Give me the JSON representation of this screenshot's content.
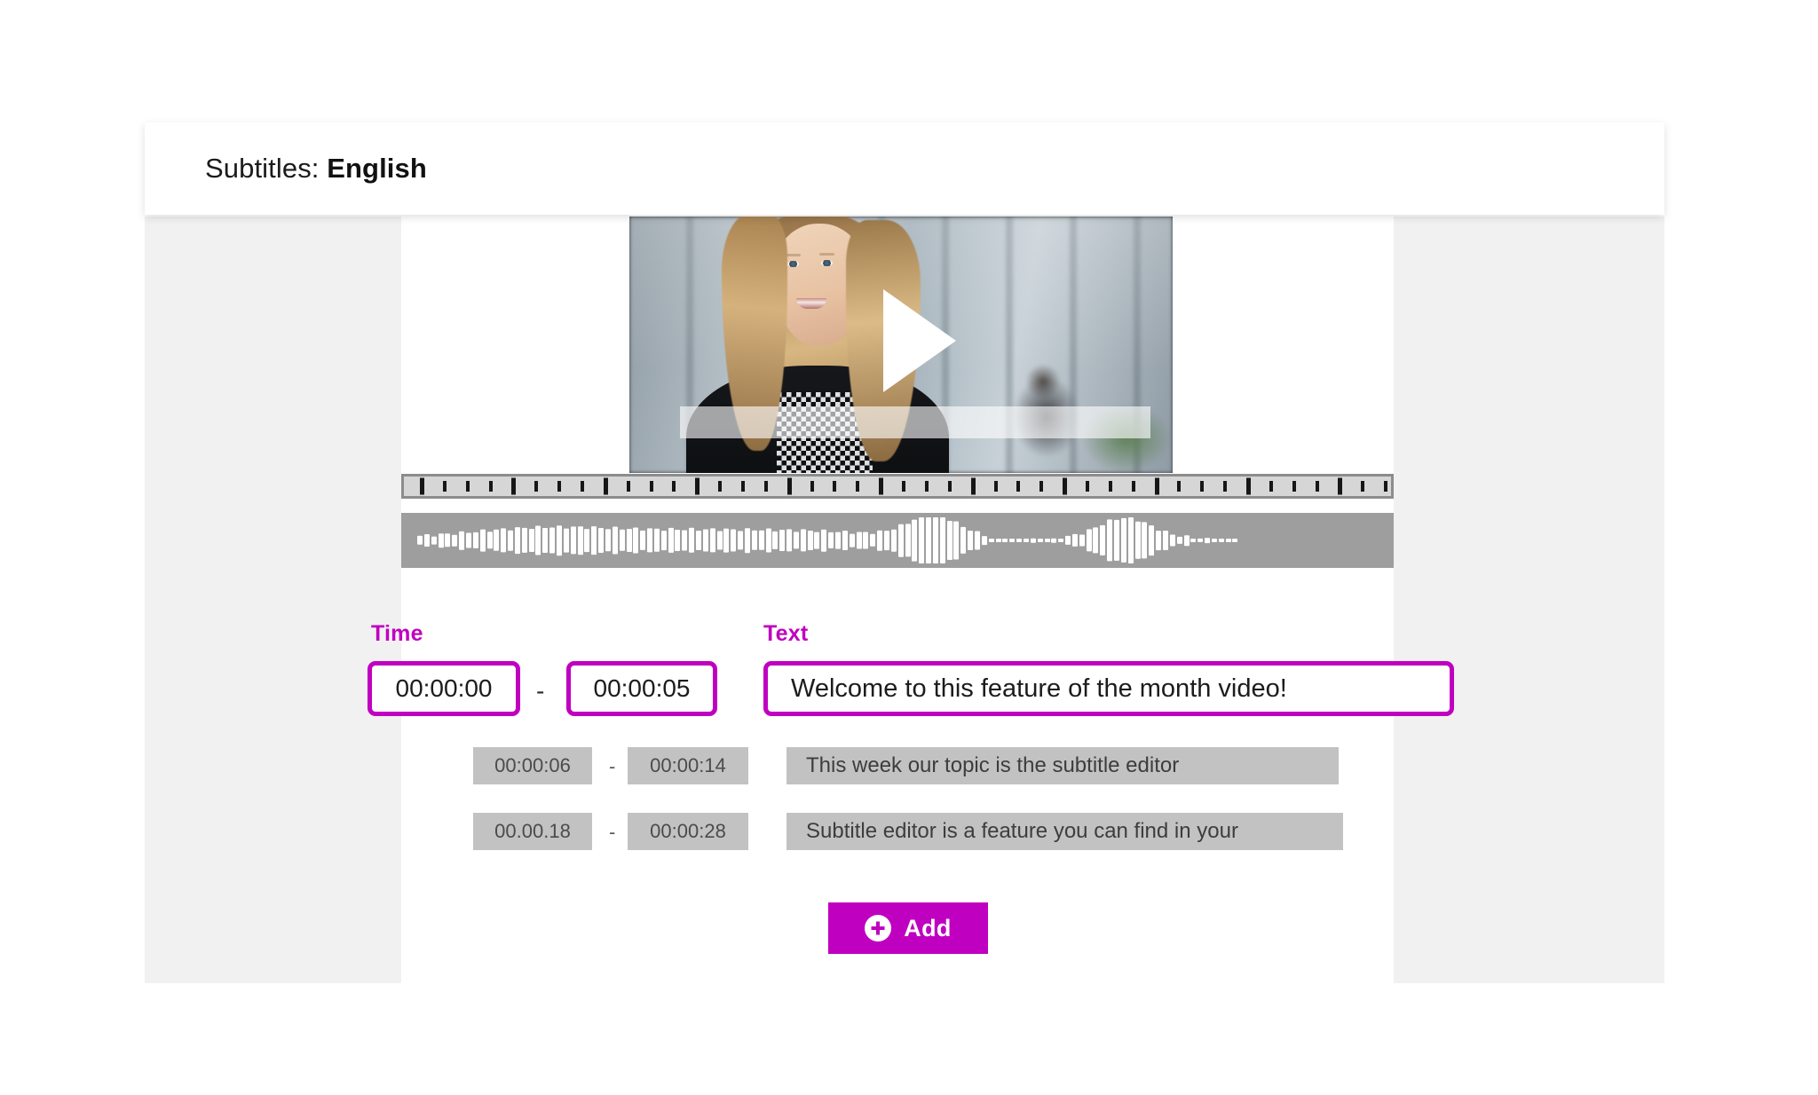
{
  "header": {
    "prefix": "Subtitles:",
    "language": "English"
  },
  "player": {
    "play_icon": "play-triangle-icon",
    "progress_bar": "video-progress-bar"
  },
  "timeline": {
    "ruler_name": "timeline-ruler",
    "waveform_name": "audio-waveform",
    "major_tick_count": 11,
    "minor_ticks_per_major": 3
  },
  "columns": {
    "time_label": "Time",
    "text_label": "Text",
    "separator": "-"
  },
  "subtitles": [
    {
      "active": true,
      "start": "00:00:00",
      "end": "00:00:05",
      "text": "Welcome to this feature of the month video!"
    },
    {
      "active": false,
      "start": "00:00:06",
      "end": "00:00:14",
      "text": "This week our topic is the subtitle editor"
    },
    {
      "active": false,
      "start": "00.00.18",
      "end": "00:00:28",
      "text": "Subtitle editor is a feature you can find in your"
    }
  ],
  "add_button": {
    "label": "Add",
    "icon": "plus-circle-icon"
  },
  "colors": {
    "accent": "#c000c0",
    "panel_gray": "#f1f1f1",
    "chip_gray": "#c2c2c2",
    "waveform_bg": "#9e9e9e",
    "ruler_bg": "#d6d6d6"
  }
}
